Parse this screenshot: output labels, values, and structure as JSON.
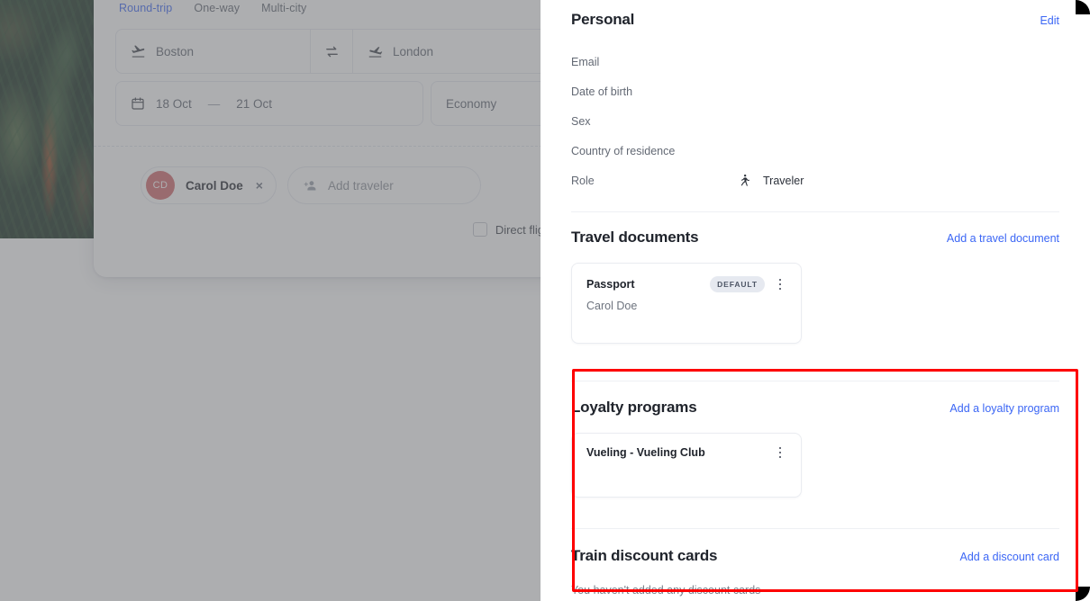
{
  "search_form": {
    "trip_tabs": [
      {
        "label": "Round-trip",
        "active": true
      },
      {
        "label": "One-way",
        "active": false
      },
      {
        "label": "Multi-city",
        "active": false
      }
    ],
    "origin": {
      "value": "Boston",
      "icon": "flight-takeoff-icon"
    },
    "destination": {
      "value": "London",
      "icon": "flight-land-icon"
    },
    "swap_icon": "swap-horizontal-icon",
    "dates": {
      "icon": "calendar-icon",
      "depart": "18 Oct",
      "separator": "—",
      "return": "21 Oct"
    },
    "cabin": {
      "value": "Economy"
    },
    "travelers": [
      {
        "initials": "CD",
        "name": "Carol Doe",
        "remove_label": "×"
      }
    ],
    "add_traveler": {
      "label": "Add traveler",
      "icon": "person-add-icon"
    },
    "direct_flight": {
      "label": "Direct flig",
      "checked": false
    }
  },
  "detail_panel": {
    "personal": {
      "title": "Personal",
      "edit_label": "Edit",
      "fields": [
        {
          "label": "Email",
          "value": ""
        },
        {
          "label": "Date of birth",
          "value": ""
        },
        {
          "label": "Sex",
          "value": ""
        },
        {
          "label": "Country of residence",
          "value": ""
        },
        {
          "label": "Role",
          "value": "Traveler",
          "icon": "traveler-walking-icon"
        }
      ]
    },
    "travel_documents": {
      "title": "Travel documents",
      "action_label": "Add a travel document",
      "items": [
        {
          "name": "Passport",
          "badge": "DEFAULT",
          "holder": "Carol Doe"
        }
      ]
    },
    "loyalty_programs": {
      "title": "Loyalty programs",
      "action_label": "Add a loyalty program",
      "items": [
        {
          "name": "Vueling - Vueling Club"
        }
      ]
    },
    "train_discount_cards": {
      "title": "Train discount cards",
      "action_label": "Add a discount card",
      "empty_message": "You haven't added any discount cards"
    }
  },
  "annotation": {
    "highlight_color": "#fe0000"
  }
}
